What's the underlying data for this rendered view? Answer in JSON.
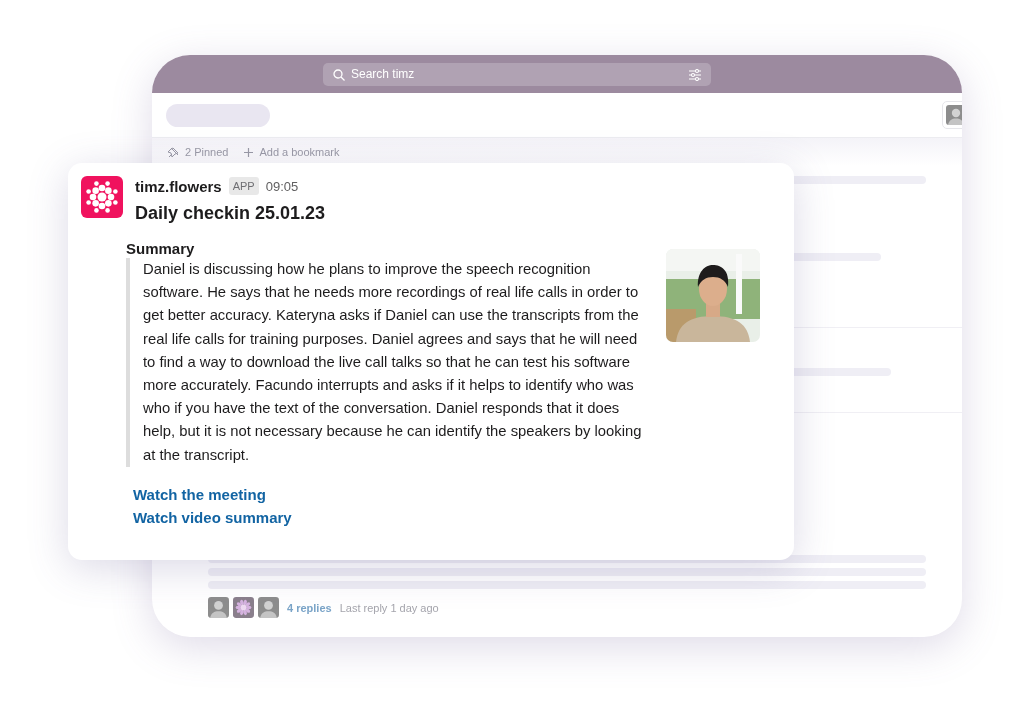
{
  "search": {
    "placeholder": "Search timz"
  },
  "pinned": {
    "label": "2 Pinned"
  },
  "bookmark": {
    "label": "Add a bookmark"
  },
  "message": {
    "sender": "timz.flowers",
    "badge": "APP",
    "time": "09:05",
    "title": "Daily checkin 25.01.23",
    "section": "Summary",
    "summary": "Daniel is discussing how he plans to improve the speech recognition software. He says that he needs more recordings of real life calls in order to get better accuracy. Kateryna asks if Daniel can use the transcripts from the real life calls for training purposes. Daniel agrees and says that he will need to find a way to download the live call talks so that he can test his software more accurately. Facundo interrupts and asks if it helps to identify who was who if you have the text of the conversation. Daniel responds that it does help, but it is not necessary because he can identify the speakers by looking at the transcript.",
    "links": [
      "Watch the meeting",
      "Watch video summary"
    ],
    "thumbnail": {
      "kind": "picture"
    }
  },
  "thread": {
    "avatars": [
      {
        "kind": "person"
      },
      {
        "kind": "flower"
      },
      {
        "kind": "person"
      }
    ],
    "replies": "4 replies",
    "last_reply": "Last reply 1 day ago"
  }
}
